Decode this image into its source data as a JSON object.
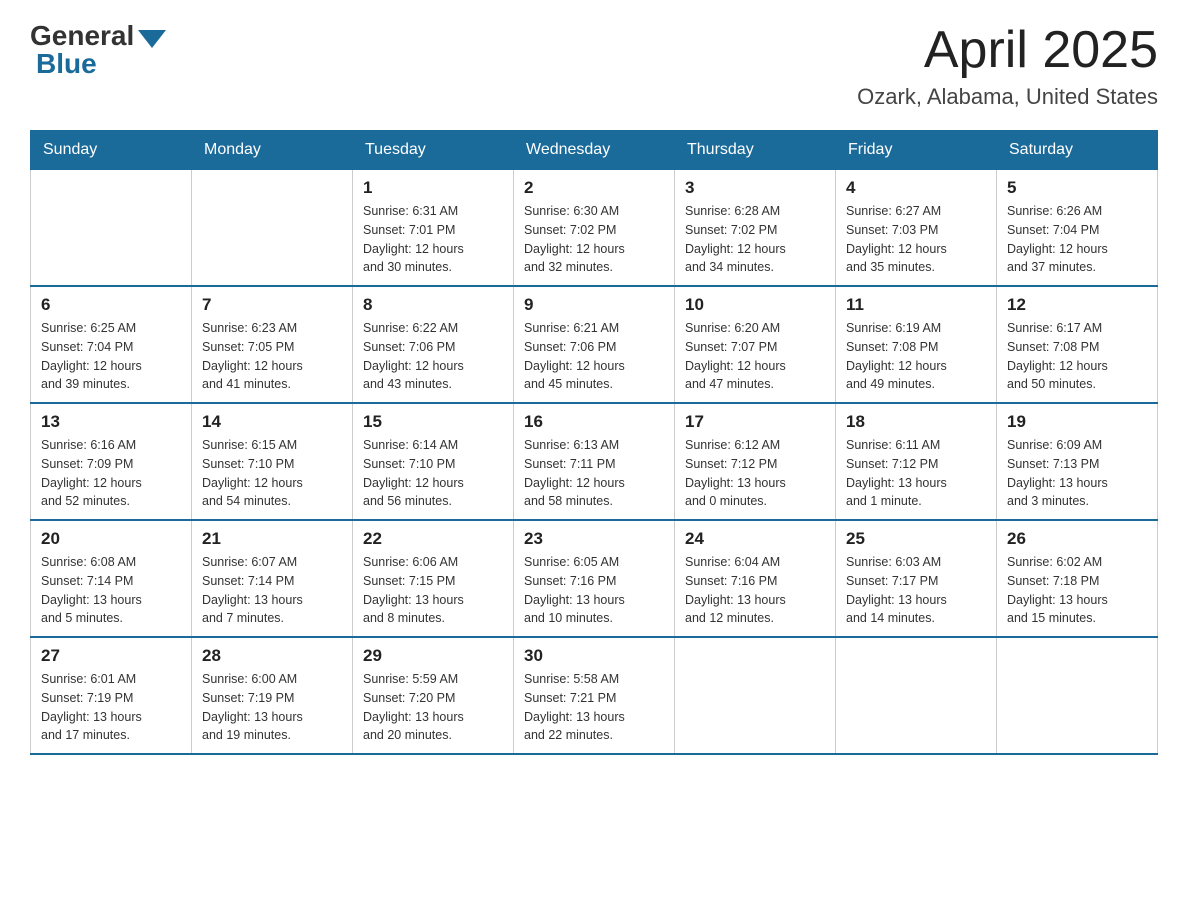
{
  "header": {
    "logo_general": "General",
    "logo_blue": "Blue",
    "logo_subtitle": "Blue",
    "month": "April 2025",
    "location": "Ozark, Alabama, United States"
  },
  "days_of_week": [
    "Sunday",
    "Monday",
    "Tuesday",
    "Wednesday",
    "Thursday",
    "Friday",
    "Saturday"
  ],
  "weeks": [
    [
      {
        "day": "",
        "info": ""
      },
      {
        "day": "",
        "info": ""
      },
      {
        "day": "1",
        "info": "Sunrise: 6:31 AM\nSunset: 7:01 PM\nDaylight: 12 hours\nand 30 minutes."
      },
      {
        "day": "2",
        "info": "Sunrise: 6:30 AM\nSunset: 7:02 PM\nDaylight: 12 hours\nand 32 minutes."
      },
      {
        "day": "3",
        "info": "Sunrise: 6:28 AM\nSunset: 7:02 PM\nDaylight: 12 hours\nand 34 minutes."
      },
      {
        "day": "4",
        "info": "Sunrise: 6:27 AM\nSunset: 7:03 PM\nDaylight: 12 hours\nand 35 minutes."
      },
      {
        "day": "5",
        "info": "Sunrise: 6:26 AM\nSunset: 7:04 PM\nDaylight: 12 hours\nand 37 minutes."
      }
    ],
    [
      {
        "day": "6",
        "info": "Sunrise: 6:25 AM\nSunset: 7:04 PM\nDaylight: 12 hours\nand 39 minutes."
      },
      {
        "day": "7",
        "info": "Sunrise: 6:23 AM\nSunset: 7:05 PM\nDaylight: 12 hours\nand 41 minutes."
      },
      {
        "day": "8",
        "info": "Sunrise: 6:22 AM\nSunset: 7:06 PM\nDaylight: 12 hours\nand 43 minutes."
      },
      {
        "day": "9",
        "info": "Sunrise: 6:21 AM\nSunset: 7:06 PM\nDaylight: 12 hours\nand 45 minutes."
      },
      {
        "day": "10",
        "info": "Sunrise: 6:20 AM\nSunset: 7:07 PM\nDaylight: 12 hours\nand 47 minutes."
      },
      {
        "day": "11",
        "info": "Sunrise: 6:19 AM\nSunset: 7:08 PM\nDaylight: 12 hours\nand 49 minutes."
      },
      {
        "day": "12",
        "info": "Sunrise: 6:17 AM\nSunset: 7:08 PM\nDaylight: 12 hours\nand 50 minutes."
      }
    ],
    [
      {
        "day": "13",
        "info": "Sunrise: 6:16 AM\nSunset: 7:09 PM\nDaylight: 12 hours\nand 52 minutes."
      },
      {
        "day": "14",
        "info": "Sunrise: 6:15 AM\nSunset: 7:10 PM\nDaylight: 12 hours\nand 54 minutes."
      },
      {
        "day": "15",
        "info": "Sunrise: 6:14 AM\nSunset: 7:10 PM\nDaylight: 12 hours\nand 56 minutes."
      },
      {
        "day": "16",
        "info": "Sunrise: 6:13 AM\nSunset: 7:11 PM\nDaylight: 12 hours\nand 58 minutes."
      },
      {
        "day": "17",
        "info": "Sunrise: 6:12 AM\nSunset: 7:12 PM\nDaylight: 13 hours\nand 0 minutes."
      },
      {
        "day": "18",
        "info": "Sunrise: 6:11 AM\nSunset: 7:12 PM\nDaylight: 13 hours\nand 1 minute."
      },
      {
        "day": "19",
        "info": "Sunrise: 6:09 AM\nSunset: 7:13 PM\nDaylight: 13 hours\nand 3 minutes."
      }
    ],
    [
      {
        "day": "20",
        "info": "Sunrise: 6:08 AM\nSunset: 7:14 PM\nDaylight: 13 hours\nand 5 minutes."
      },
      {
        "day": "21",
        "info": "Sunrise: 6:07 AM\nSunset: 7:14 PM\nDaylight: 13 hours\nand 7 minutes."
      },
      {
        "day": "22",
        "info": "Sunrise: 6:06 AM\nSunset: 7:15 PM\nDaylight: 13 hours\nand 8 minutes."
      },
      {
        "day": "23",
        "info": "Sunrise: 6:05 AM\nSunset: 7:16 PM\nDaylight: 13 hours\nand 10 minutes."
      },
      {
        "day": "24",
        "info": "Sunrise: 6:04 AM\nSunset: 7:16 PM\nDaylight: 13 hours\nand 12 minutes."
      },
      {
        "day": "25",
        "info": "Sunrise: 6:03 AM\nSunset: 7:17 PM\nDaylight: 13 hours\nand 14 minutes."
      },
      {
        "day": "26",
        "info": "Sunrise: 6:02 AM\nSunset: 7:18 PM\nDaylight: 13 hours\nand 15 minutes."
      }
    ],
    [
      {
        "day": "27",
        "info": "Sunrise: 6:01 AM\nSunset: 7:19 PM\nDaylight: 13 hours\nand 17 minutes."
      },
      {
        "day": "28",
        "info": "Sunrise: 6:00 AM\nSunset: 7:19 PM\nDaylight: 13 hours\nand 19 minutes."
      },
      {
        "day": "29",
        "info": "Sunrise: 5:59 AM\nSunset: 7:20 PM\nDaylight: 13 hours\nand 20 minutes."
      },
      {
        "day": "30",
        "info": "Sunrise: 5:58 AM\nSunset: 7:21 PM\nDaylight: 13 hours\nand 22 minutes."
      },
      {
        "day": "",
        "info": ""
      },
      {
        "day": "",
        "info": ""
      },
      {
        "day": "",
        "info": ""
      }
    ]
  ]
}
